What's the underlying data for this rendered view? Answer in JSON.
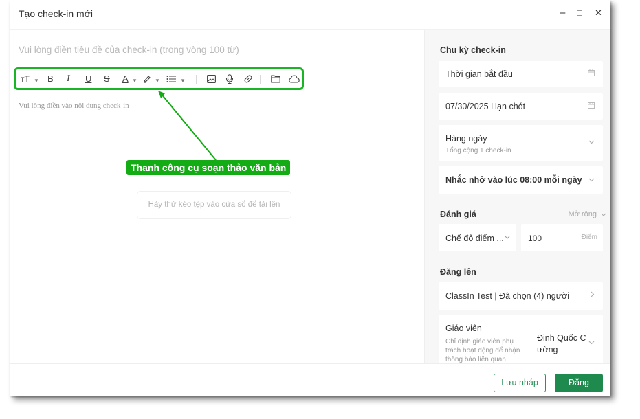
{
  "window": {
    "title": "Tạo check-in mới",
    "controls": {
      "minimize": "–",
      "maximize": "□",
      "close": "✕"
    }
  },
  "editor": {
    "title_placeholder": "Vui lòng điền tiêu đề của check-in (trong vòng 100 từ)",
    "toolbar": {
      "font_size": "тT",
      "bold": "B",
      "italic": "I",
      "underline": "U",
      "strike": "S",
      "font_color": "A",
      "caret": "▼",
      "icons": [
        "font-size-icon",
        "bold-icon",
        "italic-icon",
        "underline-icon",
        "strikethrough-icon",
        "font-color-icon",
        "highlight-icon",
        "list-icon",
        "image-icon",
        "microphone-icon",
        "link-icon",
        "folder-icon",
        "cloud-icon"
      ]
    },
    "content_placeholder": "Vui lòng điền vào nội dung check-in",
    "annotation": "Thanh công cụ soạn thảo văn bản",
    "dropzone": "Hãy thử kéo tệp vào cửa sổ để tải lên"
  },
  "panel": {
    "cycle": {
      "heading": "Chu kỳ check-in",
      "start_placeholder": "Thời gian bắt đầu",
      "deadline": "07/30/2025 Hạn chót",
      "frequency": "Hàng ngày",
      "frequency_sub": "Tổng cộng 1 check-in",
      "reminder": "Nhắc nhở vào lúc 08:00 mỗi ngày"
    },
    "rating": {
      "heading": "Đánh giá",
      "expand": "Mở rộng",
      "mode": "Chế độ điểm ...",
      "score": "100",
      "score_unit": "Điểm"
    },
    "post": {
      "heading": "Đăng lên",
      "target": "ClassIn Test | Đã chọn (4) người",
      "teacher_label": "Giáo viên",
      "teacher_desc": "Chỉ định giáo viên phụ trách hoạt động để nhận thông báo liên quan",
      "teacher_name": "Đinh Quốc C ường"
    }
  },
  "footer": {
    "draft": "Lưu nháp",
    "post": "Đăng"
  },
  "colors": {
    "accent": "#1f8a4e",
    "highlight_border": "#19b524",
    "annotation_bg": "#14ac14"
  }
}
